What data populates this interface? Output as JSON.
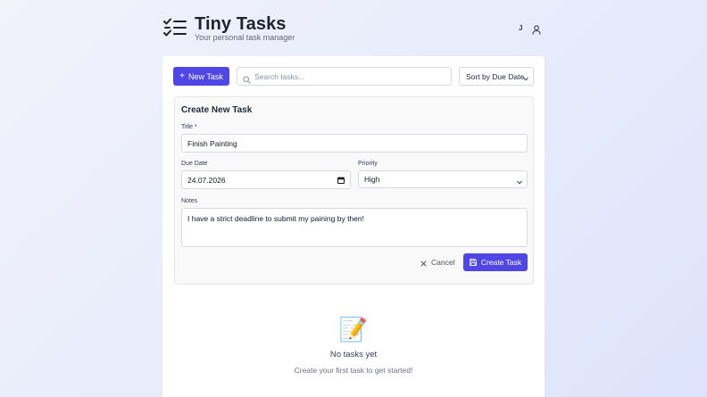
{
  "header": {
    "title": "Tiny Tasks",
    "subtitle": "Your personal task manager",
    "user_initial": "J"
  },
  "toolbar": {
    "new_task_label": "New Task",
    "search_placeholder": "Search tasks...",
    "search_value": "",
    "sort_selected": "Sort by Due Date"
  },
  "form": {
    "heading": "Create New Task",
    "title_label": "Title *",
    "title_value": "Finish Painting",
    "due_label": "Due Date",
    "due_value": "24.07.2026",
    "priority_label": "Priority",
    "priority_value": "High",
    "notes_label": "Notes",
    "notes_value": "I have a strict deadline to submit my paining by then!",
    "cancel_label": "Cancel",
    "submit_label": "Create Task"
  },
  "empty": {
    "icon": "📝",
    "title": "No tasks yet",
    "subtitle": "Create your first task to get started!"
  },
  "colors": {
    "accent": "#4f46e5",
    "background": "#e6eafb",
    "card": "#ffffff"
  },
  "icons": [
    "checklist-icon",
    "user-icon",
    "plus-icon",
    "search-icon",
    "chevron-down-icon",
    "calendar-icon",
    "close-icon",
    "save-icon",
    "memo-icon"
  ]
}
